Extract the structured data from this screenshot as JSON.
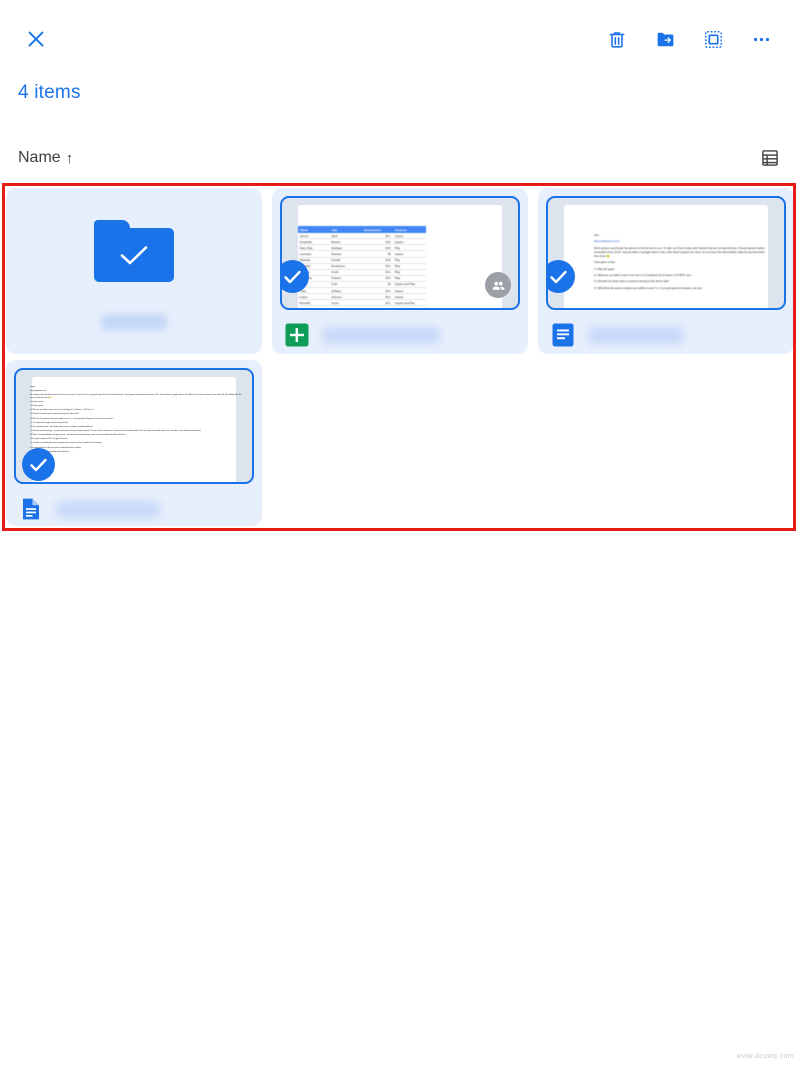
{
  "actionbar": {
    "close_label": "✕",
    "close_icon": "close-icon",
    "actions": [
      {
        "id": "delete",
        "icon": "trash-icon",
        "label": "Delete"
      },
      {
        "id": "move",
        "icon": "move-folder-icon",
        "label": "Move"
      },
      {
        "id": "select_all",
        "icon": "select-all-icon",
        "label": "Select all"
      },
      {
        "id": "more",
        "icon": "more-options-icon",
        "label": "More options"
      }
    ]
  },
  "selection": {
    "count_text": "4 items",
    "count": 4
  },
  "sort": {
    "label": "Name",
    "direction_arrow": "↑",
    "direction": "ascending"
  },
  "view": {
    "toggle_icon": "list-view-icon",
    "mode": "grid"
  },
  "annotation": {
    "border_color": "#e81c16",
    "present": true
  },
  "colors": {
    "accent": "#1a73e8",
    "card_bg": "#e8effc",
    "sheets_green": "#0f9d58",
    "docs_blue": "#1a73e8",
    "shared_gray": "#9aa0a6",
    "annotation_red": "#e81c16"
  },
  "items": [
    {
      "id": "item-folder",
      "type": "folder",
      "icon": "folder-icon",
      "selected": true,
      "name_redacted": true,
      "shared": false
    },
    {
      "id": "item-sheet",
      "type": "spreadsheet",
      "icon": "google-sheets-icon",
      "selected": true,
      "name_redacted": true,
      "shared": true,
      "preview": {
        "kind": "table",
        "columns": [
          "Name",
          "Age",
          "Temperature",
          "Purpose"
        ],
        "rows": [
          [
            "Johnny",
            "West",
            "36.1",
            "Inquire"
          ],
          [
            "Annabelle",
            "Reams",
            "33.6",
            "Inquire"
          ],
          [
            "Stacy May",
            "Santiago",
            "36.5",
            "Play"
          ],
          [
            "Leonardo",
            "Downey",
            "36",
            "Inquire"
          ],
          [
            "Maricela",
            "Fundell",
            "33.6",
            "Play"
          ],
          [
            "Vandelia",
            "Henderson",
            "35.6",
            "Play"
          ],
          [
            "Cristabe",
            "Smith",
            "36.1",
            "Play"
          ],
          [
            "Bethonnie",
            "Frahers",
            "34.5",
            "Play"
          ],
          [
            "Caleb",
            "Colin",
            "36",
            "Inquire and Play"
          ],
          [
            "Trilby",
            "Sullivan",
            "36.2",
            "Inquire"
          ],
          [
            "Lesley",
            "Johnson",
            "36.2",
            "Inquire"
          ],
          [
            "Meredith",
            "Jones",
            "36.1",
            "Inquire and Play"
          ]
        ]
      }
    },
    {
      "id": "item-doc",
      "type": "document",
      "icon": "google-docs-icon",
      "selected": true,
      "name_redacted": true,
      "shared": false,
      "preview": {
        "kind": "text",
        "lines": [
          "Visit",
          "https://playearnfi.com/",
          "We're going to go through the games on the list one by one.  To start, do 3 free to play and 3 games that are not launched yet.  Choose games ranked somewhere from 10-30.  Just put data in a google sheet or doc.  After these 5 games are done, let me know.  We will probably make the process better from there 🙂",
          "If the game is free",
          "1.) Play the game",
          "2.) What are you able to earn in an hour or 2 of playing? (# of tokens, # of NFTs, etc.)",
          "3.) Should it be pretty easy to continue earning at the above rate?",
          "4.) Will skill at the game increase your ability to earn?  i.e. if you get good at the game, can you"
        ]
      }
    },
    {
      "id": "item-doc2",
      "type": "document",
      "icon": "doc-file-icon",
      "selected": true,
      "name_redacted": true,
      "shared": false,
      "preview": {
        "kind": "text",
        "lines": [
          "Engine",
          "https://playearnfi.com/",
          "We're going to go through the games on the list one by one.  To start, do 3 free to play and 3 games that are not launched yet.  Choose games ranked somewhere from 10-30.  Just put data in a google sheet or doc.  After these 5 games are done, let me know.  We will probably make the process better from there 🙂",
          "If the game is free",
          "1.) Play the game",
          "2.) What are you able to earn in an hour or 2 of playing? (# of tokens, # of NFTs, etc.)",
          "3.) Should it be pretty easy to continue earning at the above rate?",
          "4.) Will skill at the game increase your ability to earn?  i.e. if you get good at the game, can you earn more later?",
          "5.) Is the game free to play, need to be purchased?",
          "6.) Does the game have a list of tools and/or is there an ingame activity breakdown?",
          "7.) Research market strategy -- are you interested in these pre launch proposals? Create from the metaverse -- consider accuracy and be mindful of it or the way to the market, make sure it considers a few elements of alternatives",
          "8.) Notes 2 recommendations with game group -- be informed and the borrowing, make a recommendation from these decisions",
          "9.) For game categories NFT or Crypto Purchases:",
          "a.) Consider re-evaluating the latest gameplay that elements and how to explore it for launching",
          "b.) An approximation of the time values compared by direct analytics",
          "c.) Consider any other functionalities from disclosed",
          "-- Ruby data",
          "-- And considered play",
          "-- Make a start for it part",
          "-- Make confidence"
        ]
      }
    }
  ],
  "watermark": "www.dcuwq.com"
}
